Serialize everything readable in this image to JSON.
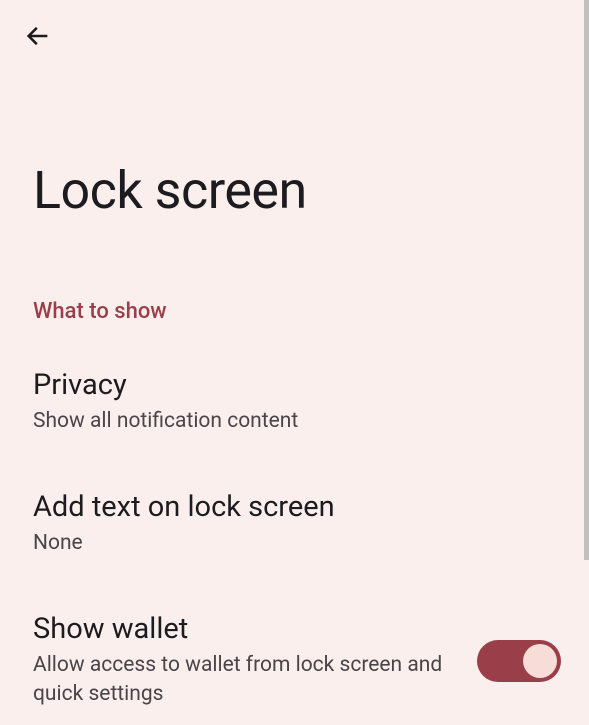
{
  "page": {
    "title": "Lock screen"
  },
  "section": {
    "header": "What to show"
  },
  "settings": {
    "privacy": {
      "title": "Privacy",
      "subtitle": "Show all notification content"
    },
    "addText": {
      "title": "Add text on lock screen",
      "subtitle": "None"
    },
    "wallet": {
      "title": "Show wallet",
      "subtitle": "Allow access to wallet from lock screen and quick settings",
      "enabled": true
    }
  }
}
